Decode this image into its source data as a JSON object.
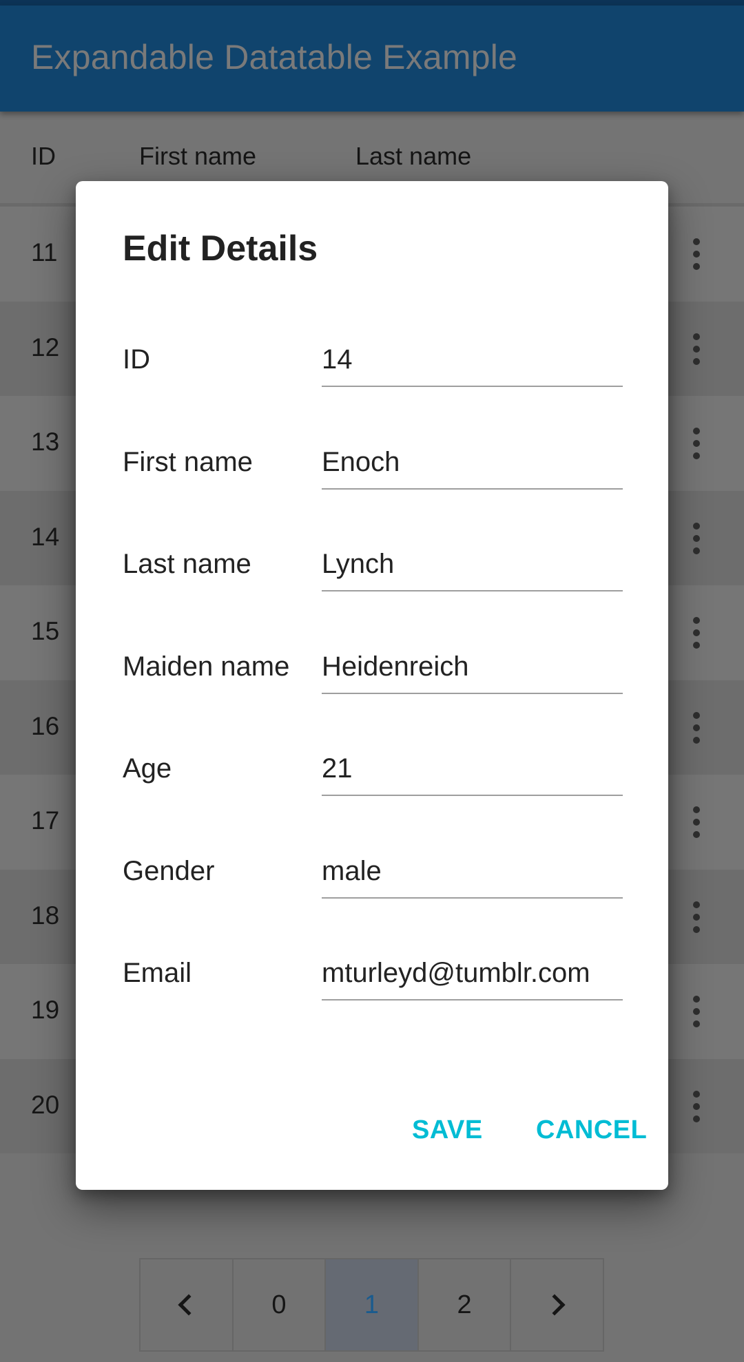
{
  "app_bar": {
    "title": "Expandable Datatable Example"
  },
  "table": {
    "columns": [
      "ID",
      "First name",
      "Last name"
    ],
    "rows": [
      {
        "id": "11"
      },
      {
        "id": "12"
      },
      {
        "id": "13"
      },
      {
        "id": "14"
      },
      {
        "id": "15"
      },
      {
        "id": "16"
      },
      {
        "id": "17"
      },
      {
        "id": "18"
      },
      {
        "id": "19"
      },
      {
        "id": "20"
      }
    ],
    "row_action_icon": "more-vert-icon"
  },
  "pagination": {
    "prev_icon": "chevron-left-icon",
    "next_icon": "chevron-right-icon",
    "pages": [
      "0",
      "1",
      "2"
    ],
    "current_page": "1"
  },
  "dialog": {
    "title": "Edit Details",
    "fields": [
      {
        "label": "ID",
        "value": "14"
      },
      {
        "label": "First name",
        "value": "Enoch"
      },
      {
        "label": "Last name",
        "value": "Lynch"
      },
      {
        "label": "Maiden name",
        "value": "Heidenreich"
      },
      {
        "label": "Age",
        "value": "21"
      },
      {
        "label": "Gender",
        "value": "male"
      },
      {
        "label": "Email",
        "value": "mturleyd@tumblr.com"
      }
    ],
    "save_label": "SAVE",
    "cancel_label": "CANCEL",
    "accent_color": "#00bcd4"
  },
  "colors": {
    "app_bar": "#10446d",
    "status_bar": "#0c3356",
    "active_page_text": "#1a5b8e"
  }
}
